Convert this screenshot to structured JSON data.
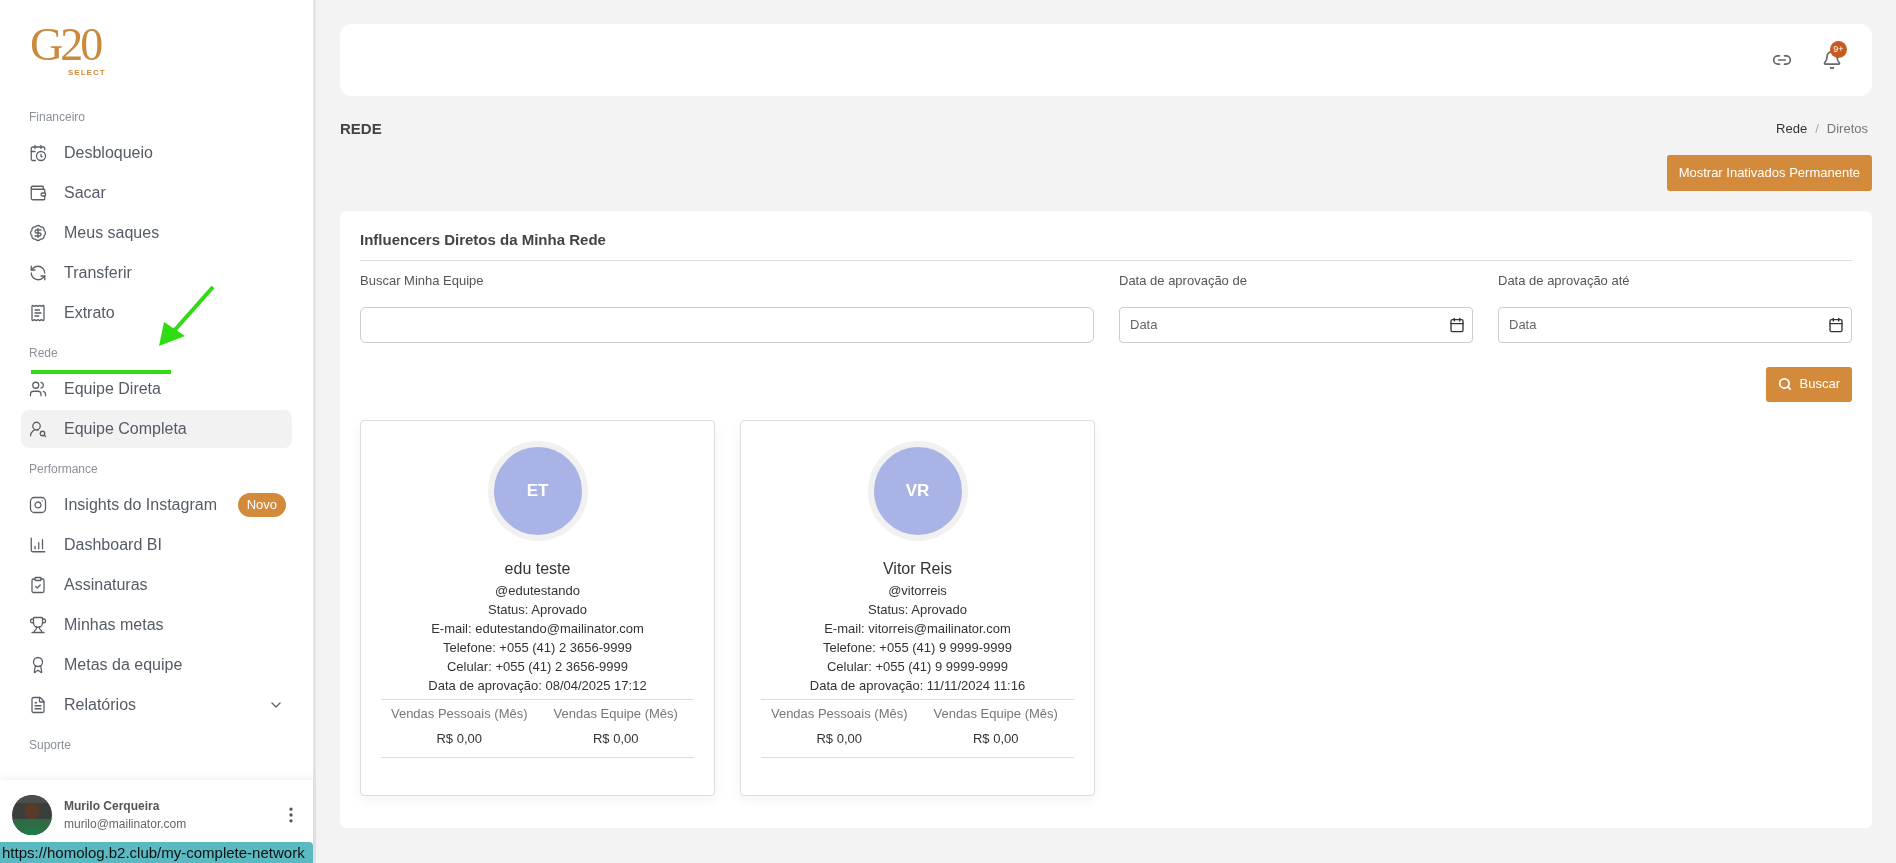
{
  "logo": {
    "title": "G20",
    "subtitle": "SELECT"
  },
  "sidebar": {
    "sections": [
      {
        "title": "Financeiro",
        "items": [
          {
            "kind": "link",
            "label": "Desbloqueio",
            "selected": false
          },
          {
            "kind": "link",
            "label": "Sacar",
            "selected": false
          },
          {
            "kind": "link",
            "label": "Meus saques",
            "selected": false
          },
          {
            "kind": "link",
            "label": "Transferir",
            "selected": false
          },
          {
            "kind": "link",
            "label": "Extrato",
            "selected": false
          }
        ]
      },
      {
        "title": "Rede",
        "items": [
          {
            "kind": "link",
            "label": "Equipe Direta",
            "selected": false
          },
          {
            "kind": "link",
            "label": "Equipe Completa",
            "selected": true
          }
        ]
      },
      {
        "title": "Performance",
        "items": [
          {
            "kind": "link",
            "label": "Insights do Instagram",
            "selected": false,
            "badge": "Novo"
          },
          {
            "kind": "link",
            "label": "Dashboard BI",
            "selected": false
          },
          {
            "kind": "link",
            "label": "Assinaturas",
            "selected": false
          },
          {
            "kind": "link",
            "label": "Minhas metas",
            "selected": false
          },
          {
            "kind": "link",
            "label": "Metas da equipe",
            "selected": false
          },
          {
            "kind": "group",
            "label": "Relatórios",
            "selected": false,
            "expanded": false
          }
        ]
      },
      {
        "title": "Suporte"
      }
    ]
  },
  "user": {
    "name": "Murilo Cerqueira",
    "email": "murilo@mailinator.com"
  },
  "status_url": "https://homolog.b2.club/my-complete-network",
  "header": {
    "notification_badge": "9+"
  },
  "page_title": "REDE",
  "breadcrumb": [
    {
      "label": "Rede",
      "current": false
    },
    {
      "label": "Diretos",
      "current": true
    }
  ],
  "breadcrumb_separator": "/",
  "show_inactive_button": "Mostrar Inativados Permanente",
  "panel": {
    "title": "Influencers Diretos da Minha Rede",
    "filters": [
      {
        "kind": "text",
        "label": "Buscar Minha Equipe"
      },
      {
        "kind": "date",
        "label": "Data de aprovação de",
        "placeholder": "Data"
      },
      {
        "kind": "date",
        "label": "Data de aprovação até",
        "placeholder": "Data"
      }
    ],
    "search_button": "Buscar",
    "cards": [
      {
        "initials": "ET",
        "name": "edu teste",
        "handle": "@edutestando",
        "lines": [
          "Status: Aprovado",
          "E-mail: edutestando@mailinator.com",
          "Telefone: +055 (41) 2 3656-9999",
          "Celular: +055 (41) 2 3656-9999",
          "Data de aprovação: 08/04/2025 17:12"
        ],
        "stats": [
          {
            "label": "Vendas Pessoais (Mês)",
            "value": "R$ 0,00"
          },
          {
            "label": "Vendas Equipe (Mês)",
            "value": "R$ 0,00"
          }
        ]
      },
      {
        "initials": "VR",
        "name": "Vitor Reis",
        "handle": "@vitorreis",
        "lines": [
          "Status: Aprovado",
          "E-mail: vitorreis@mailinator.com",
          "Telefone: +055 (41) 9 9999-9999",
          "Celular: +055 (41) 9 9999-9999",
          "Data de aprovação: 11/11/2024 11:16"
        ],
        "stats": [
          {
            "label": "Vendas Pessoais (Mês)",
            "value": "R$ 0,00"
          },
          {
            "label": "Vendas Equipe (Mês)",
            "value": "R$ 0,00"
          }
        ]
      }
    ]
  }
}
